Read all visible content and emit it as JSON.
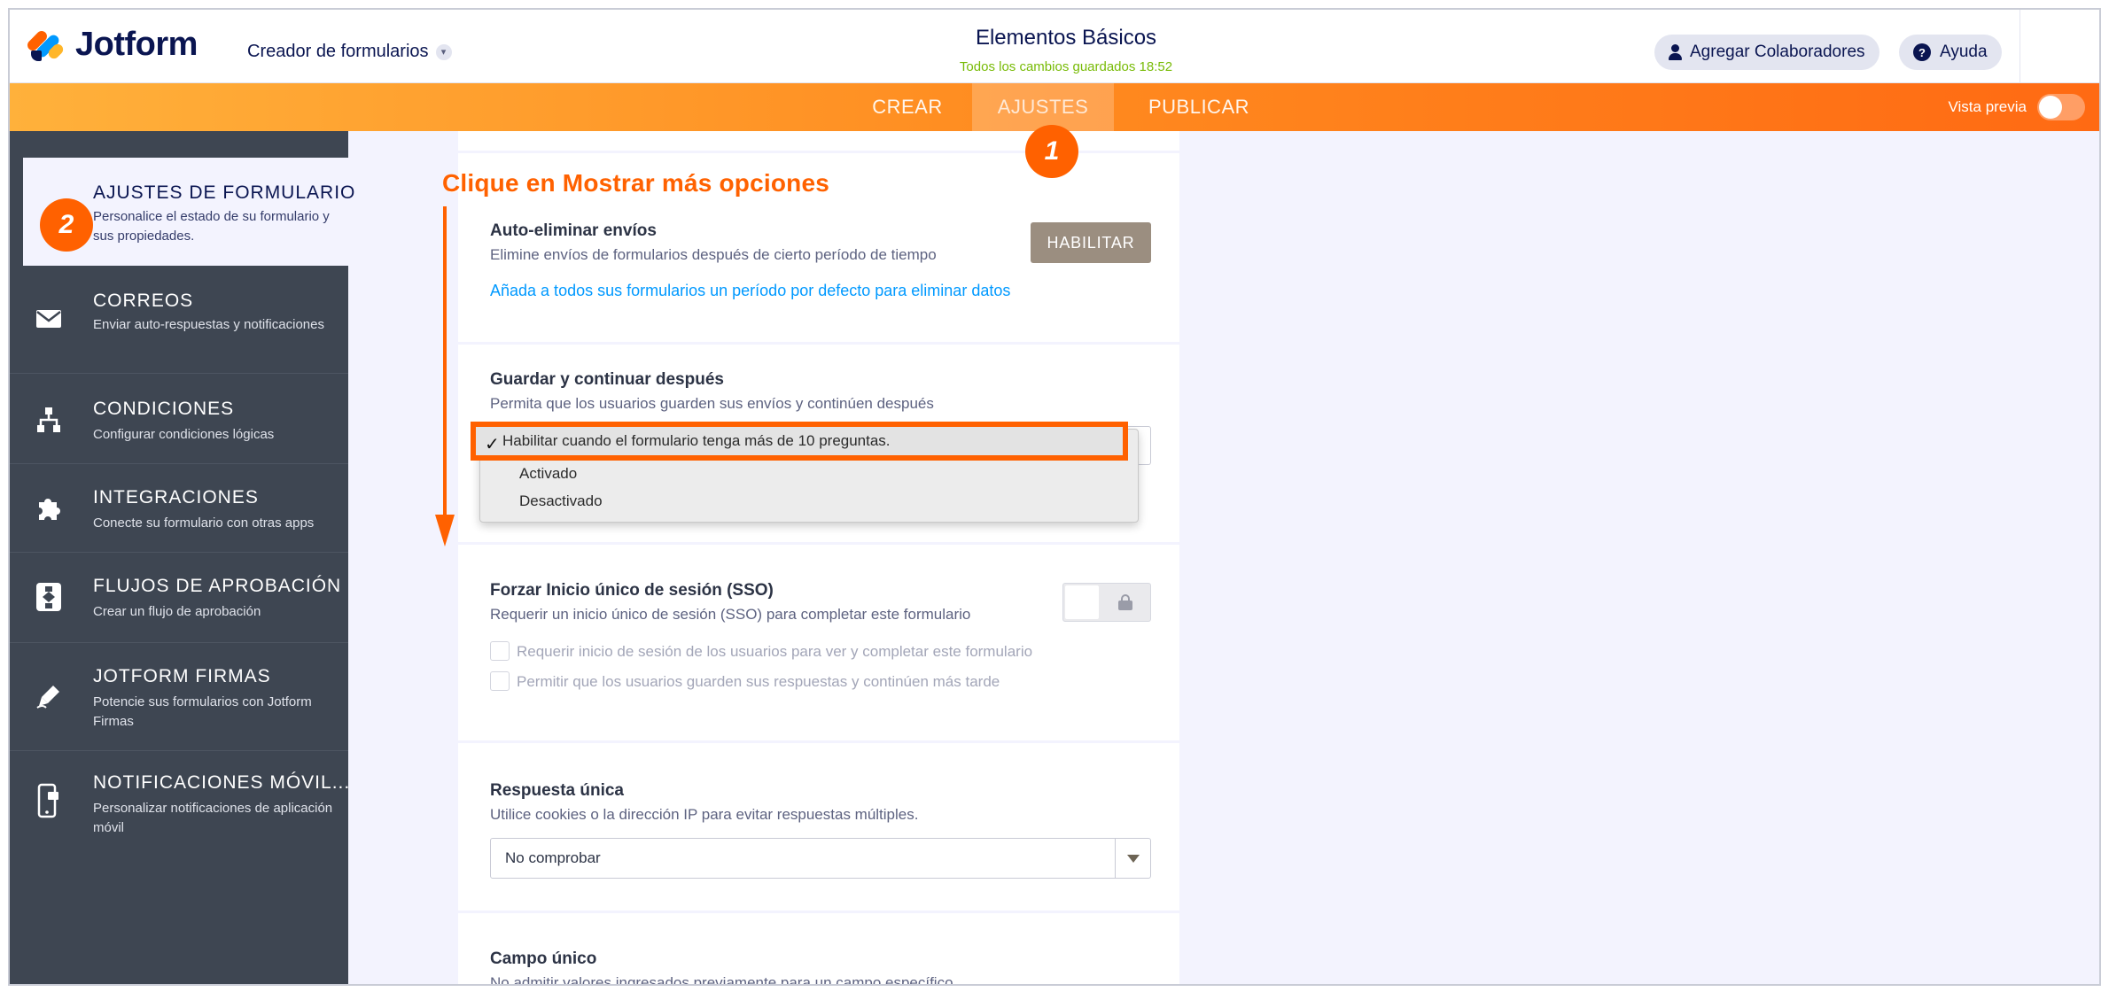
{
  "header": {
    "logo_text": "Jotform",
    "builder_label": "Creador de formularios",
    "form_title": "Elementos Básicos",
    "saved_status": "Todos los cambios guardados 18:52",
    "collab_label": "Agregar Colaboradores",
    "help_label": "Ayuda"
  },
  "nav": {
    "tabs": [
      {
        "label": "CREAR"
      },
      {
        "label": "AJUSTES"
      },
      {
        "label": "PUBLICAR"
      }
    ],
    "preview_label": "Vista previa"
  },
  "sidebar": {
    "items": [
      {
        "title": "AJUSTES DE FORMULARIO",
        "desc": "Personalice el estado de su formulario y sus propiedades."
      },
      {
        "title": "CORREOS",
        "desc": "Enviar auto-respuestas y notificaciones"
      },
      {
        "title": "CONDICIONES",
        "desc": "Configurar condiciones lógicas"
      },
      {
        "title": "INTEGRACIONES",
        "desc": "Conecte su formulario con otras apps"
      },
      {
        "title": "FLUJOS DE APROBACIÓN",
        "desc": "Crear un flujo de aprobación"
      },
      {
        "title": "JOTFORM FIRMAS",
        "desc": "Potencie sus formularios con Jotform Firmas"
      },
      {
        "title": "NOTIFICACIONES MÓVIL...",
        "desc": "Personalizar notificaciones de aplicación móvil"
      }
    ]
  },
  "content": {
    "auto_delete": {
      "label": "Auto-eliminar envíos",
      "desc": "Elimine envíos de formularios después de cierto período de tiempo",
      "button": "HABILITAR",
      "link": "Añada a todos sus formularios un período por defecto para eliminar datos"
    },
    "save_continue": {
      "label": "Guardar y continuar después",
      "desc": "Permita que los usuarios guarden sus envíos y continúen después",
      "options": [
        "Habilitar cuando el formulario tenga más de 10 preguntas.",
        "Activado",
        "Desactivado"
      ],
      "selected_mark": "✓"
    },
    "sso": {
      "label": "Forzar Inicio único de sesión (SSO)",
      "desc": "Requerir un inicio único de sesión (SSO) para completar este formulario",
      "check1": "Requerir inicio de sesión de los usuarios para ver y completar este formulario",
      "check2": "Permitir que los usuarios guarden sus respuestas y continúen más tarde"
    },
    "unique_response": {
      "label": "Respuesta única",
      "desc": "Utilice cookies o la dirección IP para evitar respuestas múltiples.",
      "value": "No comprobar"
    },
    "unique_field": {
      "label": "Campo único",
      "desc": "No admitir valores ingresados previamente para un campo específico"
    }
  },
  "annotations": {
    "instruction": "Clique en Mostrar más opciones",
    "step1": "1",
    "step2": "2",
    "color": "#ff6100"
  }
}
